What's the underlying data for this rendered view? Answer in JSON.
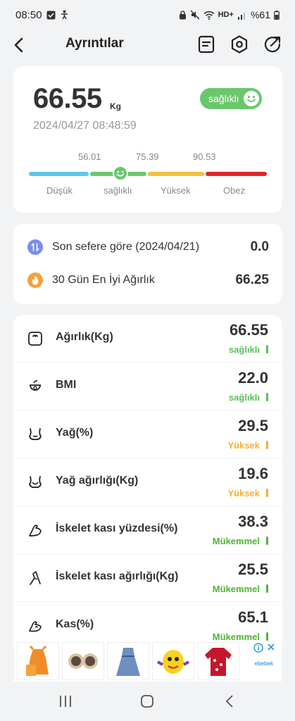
{
  "status_bar": {
    "time": "08:50",
    "network": "HD+",
    "battery": "%61",
    "icons": [
      "checkbox-icon",
      "accessibility-icon",
      "lock-icon",
      "mute-icon",
      "wifi-icon",
      "signal-icon",
      "battery-icon"
    ]
  },
  "app_bar": {
    "title": "Ayrıntılar",
    "icons": [
      "back-arrow-icon",
      "report-icon",
      "settings-hexagon-icon",
      "share-icon"
    ]
  },
  "weight": {
    "value": "66.55",
    "unit": "Kg",
    "datetime": "2024/04/27 08:48:59",
    "status": "sağlıklı",
    "status_color": "#6bc76b"
  },
  "scale": {
    "thresholds": [
      "56.01",
      "75.39",
      "90.53"
    ],
    "labels": [
      "Düşük",
      "sağlıklı",
      "Yüksek",
      "Obez"
    ],
    "colors": [
      "#5dc6ee",
      "#6bc76b",
      "#f1c340",
      "#e0262b"
    ],
    "current_value": 66.55
  },
  "comparison": {
    "rows": [
      {
        "label": "Son sefere göre (2024/04/21)",
        "value": "0.0",
        "icon": "compare-arrows-icon",
        "icon_color": "#7b8cf0"
      },
      {
        "label": "30 Gün En İyi Ağırlık",
        "value": "66.25",
        "icon": "flame-icon",
        "icon_color": "#f5a13b"
      }
    ]
  },
  "metrics": [
    {
      "label": "Ağırlık(Kg)",
      "value": "66.55",
      "status": "sağlıklı",
      "color": "#5cbf5c",
      "icon": "scale-icon"
    },
    {
      "label": "BMI",
      "value": "22.0",
      "status": "sağlıklı",
      "color": "#5cbf5c",
      "icon": "bmi-icon"
    },
    {
      "label": "Yağ(%)",
      "value": "29.5",
      "status": "Yüksek",
      "color": "#efb431",
      "icon": "body-fat-icon"
    },
    {
      "label": "Yağ ağırlığı(Kg)",
      "value": "19.6",
      "status": "Yüksek",
      "color": "#efb431",
      "icon": "fat-weight-icon"
    },
    {
      "label": "İskelet kası yüzdesi(%)",
      "value": "38.3",
      "status": "Mükemmel",
      "color": "#4fb531",
      "icon": "muscle-arm-icon"
    },
    {
      "label": "İskelet kası ağırlığı(Kg)",
      "value": "25.5",
      "status": "Mükemmel",
      "color": "#4fb531",
      "icon": "muscle-leg-icon"
    },
    {
      "label": "Kas(%)",
      "value": "65.1",
      "status": "Mükemmel",
      "color": "#4fb531",
      "icon": "flex-arm-icon"
    }
  ],
  "ad": {
    "brand": "ebebek",
    "items": [
      "orange-dress-icon",
      "kids-sunglasses-icon",
      "denim-dress-icon",
      "yellow-toy-icon",
      "red-jacket-icon"
    ]
  },
  "nav_bar": {
    "icons": [
      "recent-apps-icon",
      "home-icon",
      "back-icon"
    ]
  }
}
